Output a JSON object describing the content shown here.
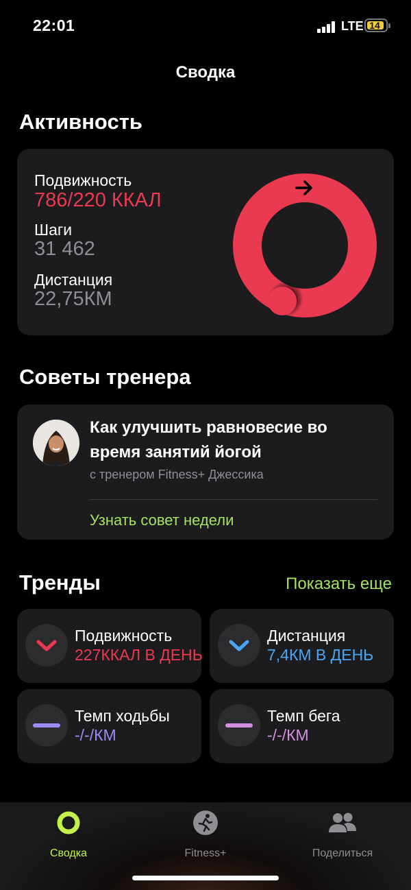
{
  "status": {
    "time": "22:01",
    "network": "LTE",
    "battery": "14",
    "battery_color": "#f2cd3a"
  },
  "nav": {
    "title": "Сводка"
  },
  "activity": {
    "section_title": "Активность",
    "move_label": "Подвижность",
    "move_value": "786/220 ККАЛ",
    "steps_label": "Шаги",
    "steps_value": "31 462",
    "distance_label": "Дистанция",
    "distance_value": "22,75КМ",
    "ring_color": "#ea3a51",
    "ring_progress": 3.57
  },
  "coach": {
    "section_title": "Советы тренера",
    "title": "Как улучшить равновесие во время занятий йогой",
    "subtitle": "с тренером Fitness+ Джессика",
    "link": "Узнать совет недели"
  },
  "trends": {
    "section_title": "Тренды",
    "show_more": "Показать еще",
    "items": [
      {
        "label": "Подвижность",
        "value": "227ККАЛ В ДЕНЬ",
        "icon": "chevron-down-icon",
        "color": "#ea3a51"
      },
      {
        "label": "Дистанция",
        "value": "7,4КМ В ДЕНЬ",
        "icon": "chevron-down-icon",
        "color": "#4aa6f5"
      },
      {
        "label": "Темп ходьбы",
        "value": "-/-/КМ",
        "icon": "dash-icon",
        "color": "#9b8cf5"
      },
      {
        "label": "Темп бега",
        "value": "-/-/КМ",
        "icon": "dash-icon",
        "color": "#d58fe0"
      }
    ]
  },
  "tab_bar": {
    "tabs": [
      {
        "label": "Сводка",
        "active": true,
        "color": "#c2f24a"
      },
      {
        "label": "Fitness+",
        "active": false
      },
      {
        "label": "Поделиться",
        "active": false
      }
    ]
  }
}
